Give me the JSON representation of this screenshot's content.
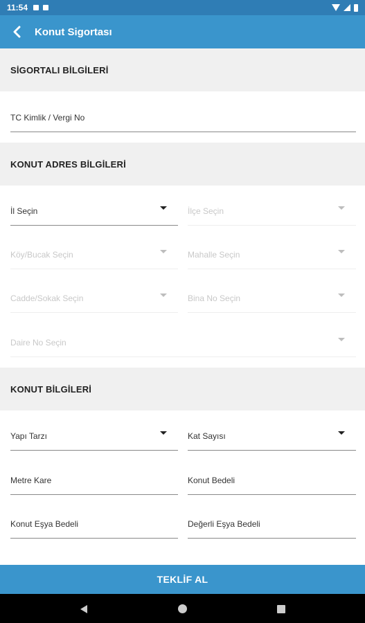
{
  "status": {
    "time": "11:54"
  },
  "header": {
    "title": "Konut Sigortası"
  },
  "sections": {
    "insured": "SİGORTALI BİLGİLERİ",
    "address": "KONUT ADRES BİLGİLERİ",
    "property": "KONUT BİLGİLERİ"
  },
  "fields": {
    "tc": "TC Kimlik / Vergi No",
    "il": "İl Seçin",
    "ilce": "İlçe Seçin",
    "koy": "Köy/Bucak Seçin",
    "mahalle": "Mahalle Seçin",
    "cadde": "Cadde/Sokak Seçin",
    "bina": "Bina No Seçin",
    "daire": "Daire No Seçin",
    "yapi": "Yapı Tarzı",
    "kat": "Kat Sayısı",
    "metre": "Metre Kare",
    "bedel": "Konut Bedeli",
    "esya": "Konut Eşya Bedeli",
    "degerli": "Değerli Eşya Bedeli"
  },
  "actions": {
    "submit": "TEKLİF AL"
  },
  "colors": {
    "app_bar": "#3a95cc",
    "status_bar": "#2f7db5",
    "section_bg": "#f0f0f0"
  }
}
